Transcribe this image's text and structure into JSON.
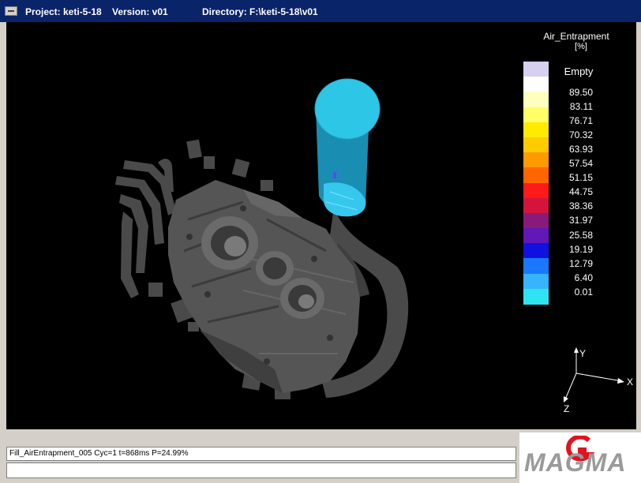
{
  "window": {
    "project_label": "Project: keti-5-18",
    "version_label": "Version: v01",
    "directory_label": "Directory: F:\\keti-5-18\\v01"
  },
  "legend": {
    "title": "Air_Entrapment",
    "unit": "[%]",
    "empty_label": "Empty",
    "values": [
      "89.50",
      "83.11",
      "76.71",
      "70.32",
      "63.93",
      "57.54",
      "51.15",
      "44.75",
      "38.36",
      "31.97",
      "25.58",
      "19.19",
      "12.79",
      "6.40",
      "0.01"
    ],
    "colors": [
      "#d8d0f0",
      "#ffffff",
      "#ffffc0",
      "#ffff66",
      "#ffea00",
      "#ffcc00",
      "#ff9a00",
      "#ff6600",
      "#ff1a1a",
      "#d4143c",
      "#8a1a7a",
      "#6018b8",
      "#1010e0",
      "#1a78ff",
      "#36b4ff",
      "#2ee4f0"
    ]
  },
  "axes": {
    "x_label": "X",
    "y_label": "Y",
    "z_label": "Z"
  },
  "status": {
    "line1": "Fill_AirEntrapment_005 Cyc=1 t=868ms P=24.99%",
    "line2": ""
  },
  "logo": {
    "text": "MAGMA"
  },
  "colors": {
    "casting": "#4a4a4a",
    "metal": "#2ec6e6",
    "titlebar": "#0a246a"
  }
}
